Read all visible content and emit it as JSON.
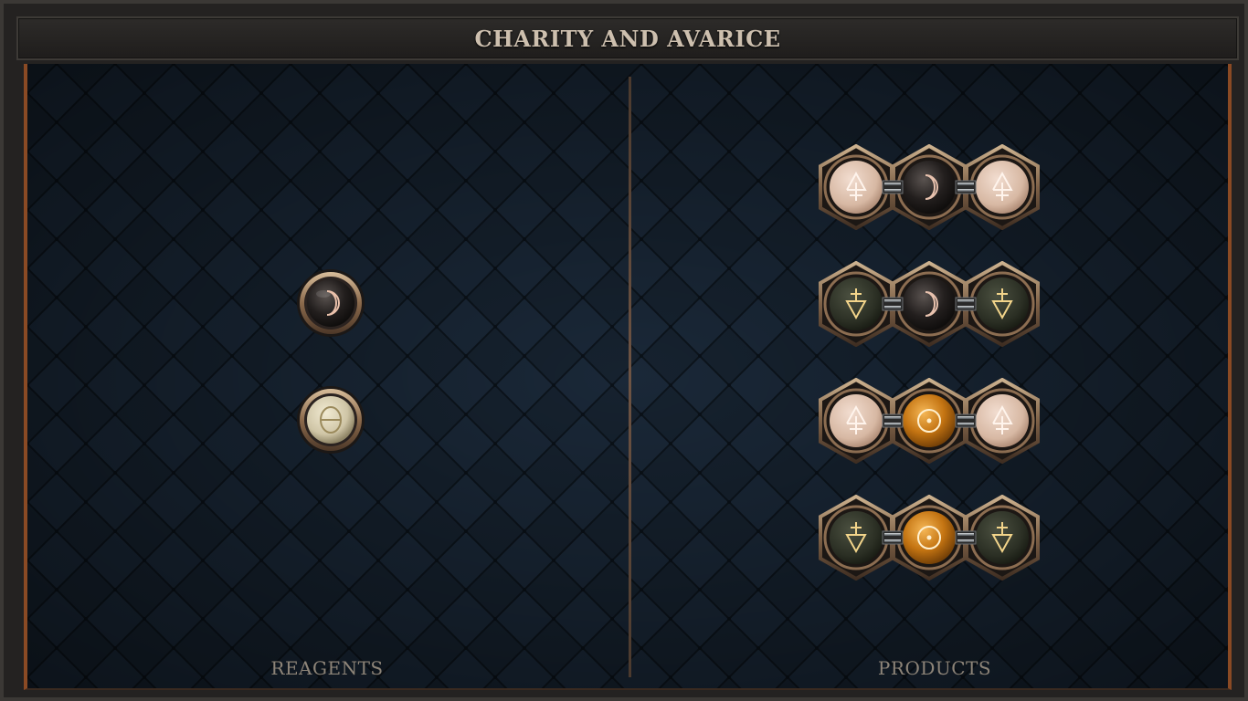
{
  "window": {
    "title": "CHARITY AND AVARICE"
  },
  "reagents": {
    "label": "REAGENTS",
    "items": [
      {
        "name": "moon",
        "symbol": "☽",
        "orb_color": "#2b2726",
        "glyph_color": "#e6b9a5"
      },
      {
        "name": "theta",
        "symbol": "θ",
        "orb_color": "#d9d0b6",
        "glyph_color": "#8a7a52"
      }
    ]
  },
  "products": {
    "label": "PRODUCTS",
    "rows": [
      {
        "left": "fire-cross",
        "center": "moon",
        "right": "fire-cross"
      },
      {
        "left": "water-cross",
        "center": "moon",
        "right": "water-cross"
      },
      {
        "left": "fire-cross",
        "center": "sun",
        "right": "fire-cross"
      },
      {
        "left": "water-cross",
        "center": "sun",
        "right": "water-cross"
      }
    ]
  },
  "colors": {
    "frame_bg": "#242221",
    "board_bg": "#14202c",
    "accent_orange": "#8a4a24",
    "title_text": "#cdbfae",
    "label_text": "#8d8478",
    "bronze": "#a58567",
    "fire_orb": "#dcbfaa",
    "water_orb": "#2d3125",
    "moon_orb": "#262321",
    "sun_orb": "#c77c18"
  },
  "icons": {
    "fire-cross": "fire-cross-icon",
    "water-cross": "water-cross-icon",
    "moon": "moon-icon",
    "sun": "sun-icon",
    "theta": "theta-icon"
  }
}
